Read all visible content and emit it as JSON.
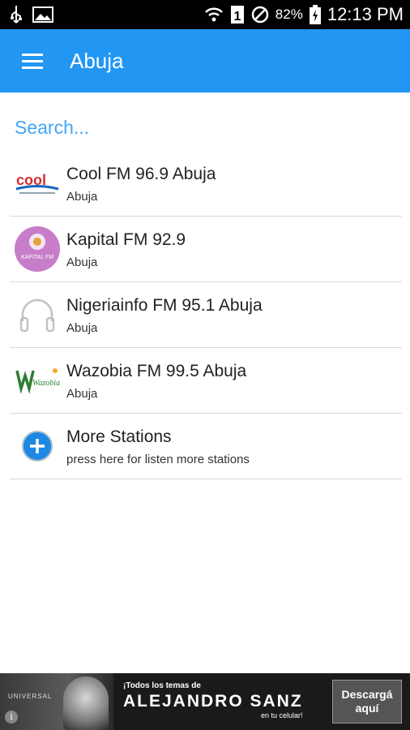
{
  "status_bar": {
    "icons": [
      "usb-icon",
      "image-icon",
      "wifi-icon",
      "sim-icon",
      "no-disturb-icon",
      "battery-icon"
    ],
    "sim_label": "1",
    "battery": "82%",
    "time": "12:13 PM"
  },
  "app_bar": {
    "title": "Abuja",
    "menu_icon": "hamburger-icon"
  },
  "search": {
    "placeholder": "Search..."
  },
  "stations": [
    {
      "name": "Cool FM 96.9 Abuja",
      "city": "Abuja",
      "logo_text": "cool"
    },
    {
      "name": "Kapital FM 92.9",
      "city": "Abuja",
      "logo_text": "KAPITAL FM"
    },
    {
      "name": "Nigeriainfo FM 95.1 Abuja",
      "city": "Abuja",
      "logo_text": ""
    },
    {
      "name": "Wazobia FM 99.5 Abuja",
      "city": "Abuja",
      "logo_text": "Wazobia"
    }
  ],
  "more": {
    "title": "More Stations",
    "subtitle": "press here for listen more stations",
    "icon": "plus-circle-icon"
  },
  "ad": {
    "brand": "UNIVERSAL",
    "line1": "¡Todos los temas de",
    "artist": "ALEJANDRO SANZ",
    "line3": "en tu celular!",
    "cta": "Descargá aquí",
    "info": "i"
  },
  "colors": {
    "app_bar": "#2196f3",
    "search": "#42a5f5",
    "plus": "#1e88e5"
  }
}
